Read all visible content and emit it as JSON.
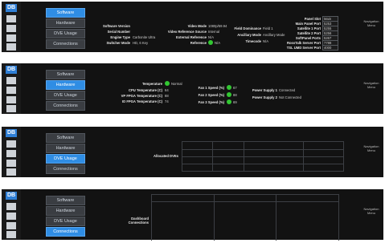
{
  "nav": [
    "Software",
    "Hardware",
    "DVE Usage",
    "Connections"
  ],
  "side_label": [
    "Navigation",
    "Menu"
  ],
  "software": {
    "labels": [
      "Software Version",
      "Serial Number",
      "Engine Type",
      "Switcher Mode"
    ],
    "values": [
      "",
      "",
      "Carbonite Ultra",
      "HD, 6 Key"
    ],
    "mid_labels": [
      "Video Mode",
      "Video Reference Source",
      "External Reference",
      "Reference"
    ],
    "mid_values": [
      "1080p/59.94",
      "Internal",
      "N/A",
      "N/A"
    ],
    "field_labels": [
      "Field Dominance",
      "Ancillary Mode",
      "Timecode"
    ],
    "field_values": [
      "Field 1",
      "Pass",
      "N/A"
    ],
    "port_labels": [
      "Panel Slot",
      "Main Panel Port",
      "Satellite 1 Port",
      "Satellite 2 Port",
      "SoftPanel Ports",
      "RossTalk Server Port",
      "TSL UMD Server Port"
    ],
    "port_values": [
      "Main",
      "5253",
      "5255",
      "5256",
      "5267",
      "7788",
      "4000"
    ]
  },
  "hardware": {
    "temp_labels": [
      "Temperature",
      "CPU Temperature (C)",
      "VP FPGA Temperature (C)",
      "IO FPGA Temperature (C)"
    ],
    "temp_values": [
      "Normal",
      "64",
      "88",
      "74"
    ],
    "fan_labels": [
      "Fan 1 Speed (%)",
      "Fan 2 Speed (%)",
      "Fan 3 Speed (%)"
    ],
    "fan_values": [
      "67",
      "88",
      "69"
    ],
    "psu_labels": [
      "Power Supply 1",
      "Power Supply 2"
    ],
    "psu_values": [
      "Connected",
      "Not Connected"
    ]
  },
  "dve": {
    "label": "Allocated DVEs"
  },
  "connections": {
    "label": [
      "Dashboard",
      "Connections"
    ]
  },
  "colors": {
    "active": "#2f8de4",
    "ok": "#32c732",
    "panel": "#121212"
  }
}
